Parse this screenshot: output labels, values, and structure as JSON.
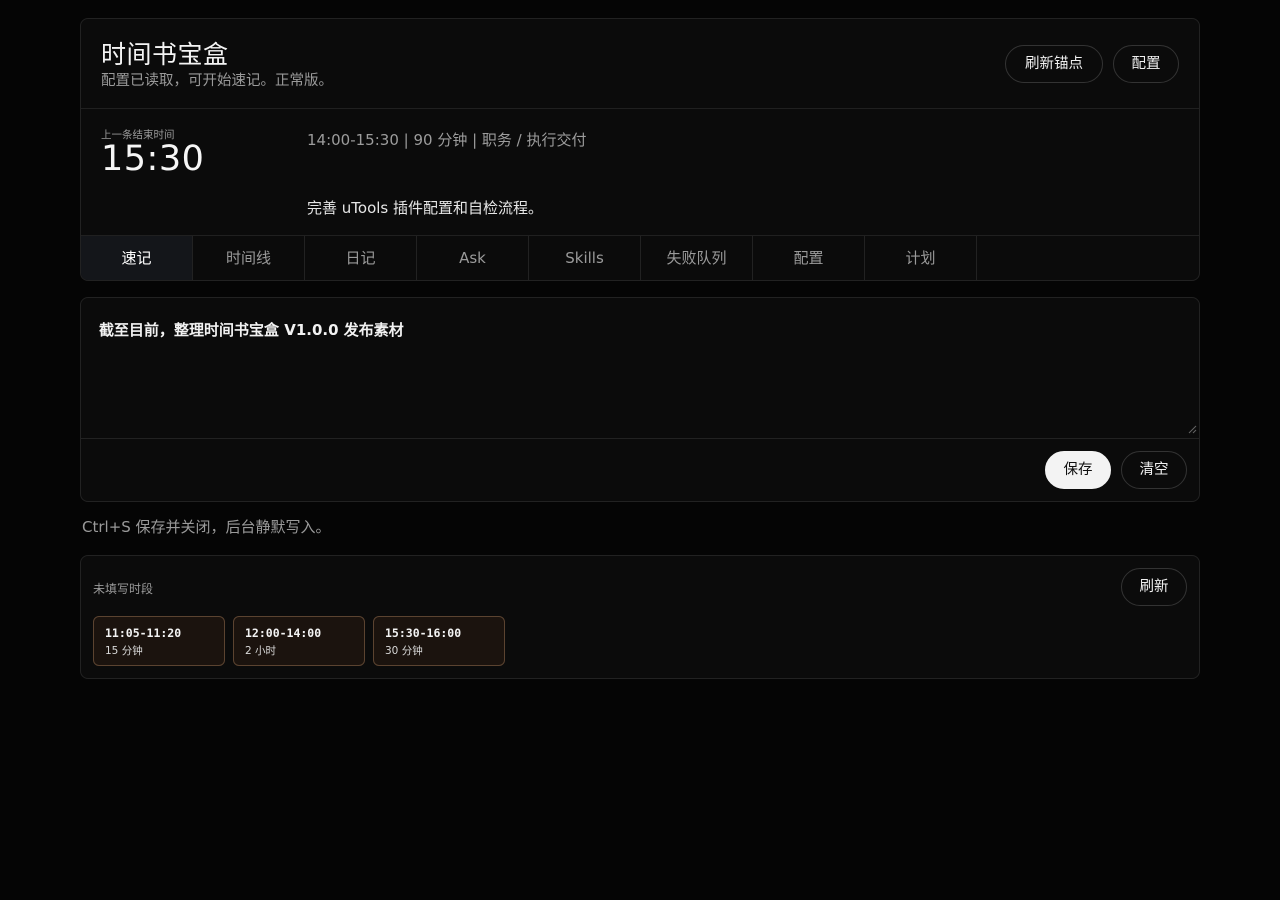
{
  "header": {
    "title": "时间书宝盒",
    "status": "配置已读取，可开始速记。正常版。",
    "refresh_anchor_label": "刷新锚点",
    "config_label": "配置"
  },
  "anchor": {
    "caption": "上一条结束时间",
    "time": "15:30",
    "meta": "14:00-15:30 | 90 分钟 | 职务 / 执行交付",
    "description": "完善 uTools 插件配置和自检流程。"
  },
  "tabs": [
    {
      "label": "速记",
      "active": true
    },
    {
      "label": "时间线",
      "active": false
    },
    {
      "label": "日记",
      "active": false
    },
    {
      "label": "Ask",
      "active": false
    },
    {
      "label": "Skills",
      "active": false
    },
    {
      "label": "失败队列",
      "active": false
    },
    {
      "label": "配置",
      "active": false
    },
    {
      "label": "计划",
      "active": false
    }
  ],
  "editor": {
    "text": "截至目前，整理时间书宝盒 V1.0.0 发布素材",
    "save_label": "保存",
    "clear_label": "清空"
  },
  "hint": "Ctrl+S 保存并关闭，后台静默写入。",
  "gaps": {
    "title": "未填写时段",
    "refresh_label": "刷新",
    "items": [
      {
        "range": "11:05-11:20",
        "duration": "15 分钟"
      },
      {
        "range": "12:00-14:00",
        "duration": "2 小时"
      },
      {
        "range": "15:30-16:00",
        "duration": "30 分钟"
      }
    ]
  },
  "colors": {
    "background": "#050505",
    "card": "#0b0b0b",
    "chip_bg": "#1b130e",
    "chip_border": "#5b4330",
    "primary_button": "#f3f3f3"
  }
}
